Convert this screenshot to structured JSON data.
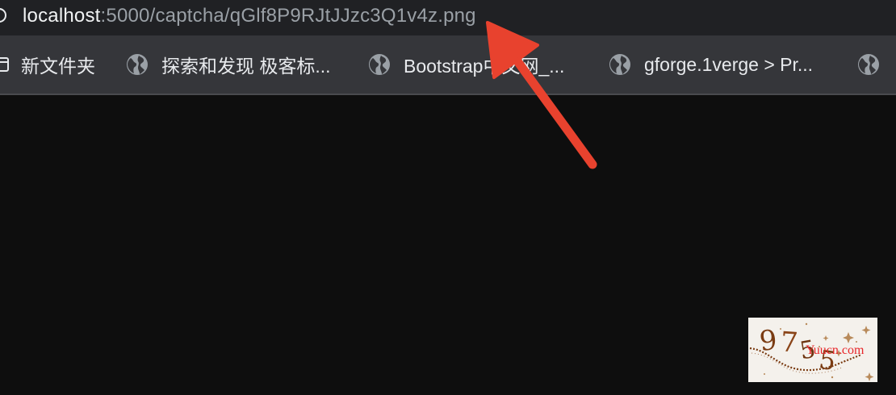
{
  "address_bar": {
    "url_host": "localhost",
    "url_path": ":5000/captcha/qGlf8P9RJtJJzc3Q1v4z.png"
  },
  "bookmarks": [
    {
      "label": "新文件夹",
      "icon": "folder-icon"
    },
    {
      "label": "探索和发现 极客标...",
      "icon": "globe-icon"
    },
    {
      "label": "Bootstrap中文网_...",
      "icon": "globe-icon"
    },
    {
      "label": "gforge.1verge > Pr...",
      "icon": "globe-icon"
    },
    {
      "label": "",
      "icon": "globe-icon"
    }
  ],
  "captcha": {
    "text": "9755"
  },
  "watermark": "Yuucn.com",
  "colors": {
    "address_bar_bg": "#202124",
    "bookmarks_bar_bg": "#35363a",
    "page_bg": "#0e0e0e",
    "annotation_arrow": "#e8422e",
    "captcha_ink": "#7a3b12"
  }
}
